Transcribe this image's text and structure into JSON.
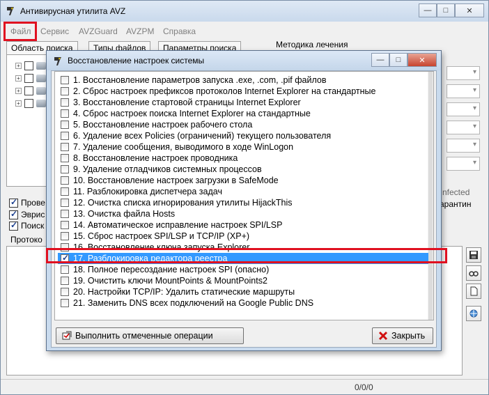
{
  "app": {
    "title": "Антивирусная утилита AVZ"
  },
  "menu": [
    "Файл",
    "Сервис",
    "AVZGuard",
    "AVZPM",
    "Справка"
  ],
  "tabs": [
    "Область поиска",
    "Типы файлов",
    "Параметры поиска"
  ],
  "right_panel": {
    "group_label": "Методика лечения",
    "infected_text": "nfected",
    "quarantine_text": "арантин"
  },
  "left_checks": [
    {
      "label": "Прове",
      "checked": true
    },
    {
      "label": "Эврис",
      "checked": true
    },
    {
      "label": "Поиск",
      "checked": true
    }
  ],
  "protocol_label": "Протоко",
  "status": {
    "counter": "0/0/0"
  },
  "dialog": {
    "title": "Восстановление настроек системы",
    "items": [
      {
        "label": "1. Восстановление параметров запуска .exe, .com, .pif файлов",
        "checked": false,
        "selected": false
      },
      {
        "label": "2. Сброс настроек префиксов протоколов Internet Explorer на стандартные",
        "checked": false,
        "selected": false
      },
      {
        "label": "3. Восстановление стартовой страницы Internet Explorer",
        "checked": false,
        "selected": false
      },
      {
        "label": "4. Сброс настроек поиска Internet Explorer на стандартные",
        "checked": false,
        "selected": false
      },
      {
        "label": "5. Восстановление настроек рабочего стола",
        "checked": false,
        "selected": false
      },
      {
        "label": "6. Удаление всех Policies (ограничений) текущего пользователя",
        "checked": false,
        "selected": false
      },
      {
        "label": "7. Удаление сообщения, выводимого в ходе WinLogon",
        "checked": false,
        "selected": false
      },
      {
        "label": "8. Восстановление настроек проводника",
        "checked": false,
        "selected": false
      },
      {
        "label": "9. Удаление отладчиков системных процессов",
        "checked": false,
        "selected": false
      },
      {
        "label": "10. Восстановление настроек загрузки в SafeMode",
        "checked": false,
        "selected": false
      },
      {
        "label": "11. Разблокировка диспетчера задач",
        "checked": false,
        "selected": false
      },
      {
        "label": "12. Очистка списка игнорирования утилиты HijackThis",
        "checked": false,
        "selected": false
      },
      {
        "label": "13. Очистка файла Hosts",
        "checked": false,
        "selected": false
      },
      {
        "label": "14. Автоматическое исправление настроек SPI/LSP",
        "checked": false,
        "selected": false
      },
      {
        "label": "15. Сброс настроек SPI/LSP и TCP/IP (XP+)",
        "checked": false,
        "selected": false
      },
      {
        "label": "16. Восстановление ключа запуска Explorer",
        "checked": false,
        "selected": false
      },
      {
        "label": "17. Разблокировка редактора реестра",
        "checked": true,
        "selected": true
      },
      {
        "label": "18. Полное пересоздание настроек SPI (опасно)",
        "checked": false,
        "selected": false
      },
      {
        "label": "19. Очистить ключи MountPoints & MountPoints2",
        "checked": false,
        "selected": false
      },
      {
        "label": "20. Настройки TCP/IP: Удалить статические маршруты",
        "checked": false,
        "selected": false
      },
      {
        "label": "21. Заменить DNS всех подключений на Google Public DNS",
        "checked": false,
        "selected": false
      }
    ],
    "execute_button": "Выполнить отмеченные операции",
    "close_button": "Закрыть"
  },
  "colors": {
    "selection": "#3399ff",
    "highlight_red": "#e01020"
  }
}
